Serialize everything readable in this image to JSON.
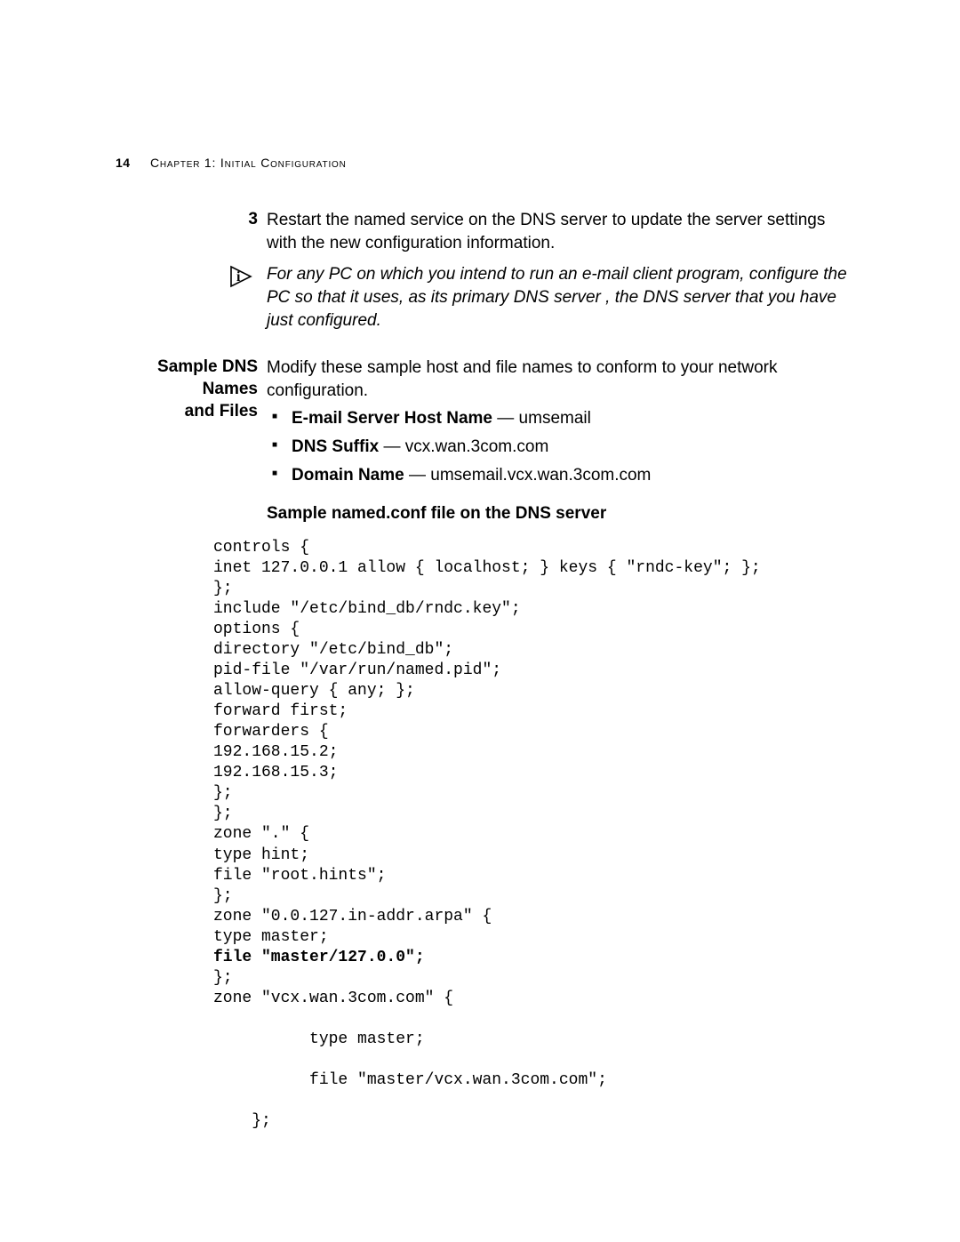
{
  "header": {
    "page_number": "14",
    "chapter": "Chapter 1: Initial Configuration"
  },
  "step3": {
    "number": "3",
    "text": "Restart the named service on the DNS server to update the server settings with the new configuration information."
  },
  "note": {
    "text": "For any PC on which you intend to run an e-mail client program, configure the PC so that it uses, as its primary DNS server , the DNS server that you have just configured."
  },
  "section": {
    "margin_title_line1": "Sample DNS Names",
    "margin_title_line2": "and Files",
    "intro": "Modify these sample host and file names to conform to your network configuration.",
    "bullet_email_label": "E-mail Server Host Name",
    "bullet_email_value": " — umsemail",
    "bullet_suffix_label": "DNS Suffix",
    "bullet_suffix_value": " — vcx.wan.3com.com",
    "bullet_domain_label": "Domain Name",
    "bullet_domain_value": " — umsemail.vcx.wan.3com.com",
    "subheading": "Sample named.conf file on the DNS server"
  },
  "code": {
    "l01": "controls {",
    "l02": "inet 127.0.0.1 allow { localhost; } keys { \"rndc-key\"; };",
    "l03": "};",
    "l04": "include \"/etc/bind_db/rndc.key\";",
    "l05": "options {",
    "l06": "directory \"/etc/bind_db\";",
    "l07": "pid-file \"/var/run/named.pid\";",
    "l08": "allow-query { any; };",
    "l09": "forward first;",
    "l10": "forwarders {",
    "l11": "192.168.15.2;",
    "l12": "192.168.15.3;",
    "l13": "};",
    "l14": "};",
    "l15": "zone \".\" {",
    "l16": "type hint;",
    "l17": "file \"root.hints\";",
    "l18": "};",
    "l19": "zone \"0.0.127.in-addr.arpa\" {",
    "l20": "type master;",
    "l21": "file \"master/127.0.0\";",
    "l22": "};",
    "l23": "zone \"vcx.wan.3com.com\" {",
    "l24": "          type master;",
    "l25": "          file \"master/vcx.wan.3com.com\";",
    "l26": "    };"
  }
}
